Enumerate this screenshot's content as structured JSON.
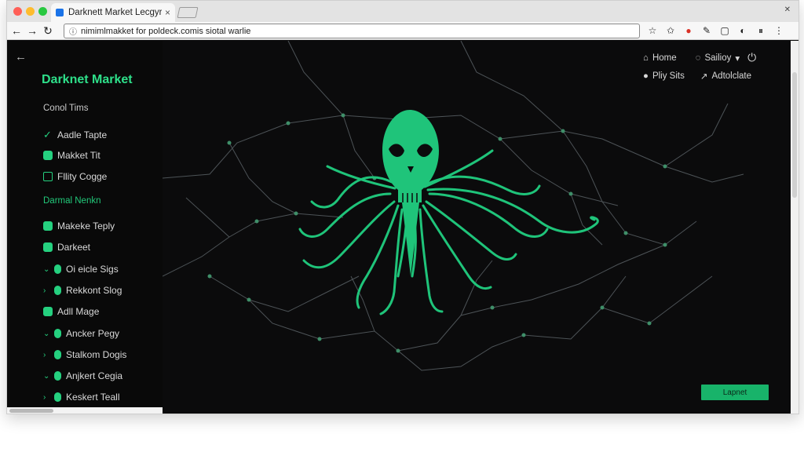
{
  "browser": {
    "tab_title": "Darknett Market Lecgyr",
    "url": "nimimlmakket for poldeck.comis siotal warlie",
    "traffic_lights": [
      "#ff5f57",
      "#febc2e",
      "#28c840"
    ]
  },
  "sidebar": {
    "brand": "Darknet Market",
    "section1_title": "Conol Tims",
    "section2_title": "Darmal Nenkn",
    "items": [
      {
        "label": "Aadle Tapte",
        "icon": "check-icon",
        "chev": ""
      },
      {
        "label": "Makket Tit",
        "icon": "square-filled-icon",
        "chev": ""
      },
      {
        "label": "Fllity Cogge",
        "icon": "square-outline-icon",
        "chev": ""
      },
      {
        "label": "Makeke Teply",
        "icon": "square-filled-icon",
        "chev": ""
      },
      {
        "label": "Darkeet",
        "icon": "square-filled-icon",
        "chev": ""
      },
      {
        "label": "Oi eicle Sigs",
        "icon": "pill-icon",
        "chev": "⌄"
      },
      {
        "label": "Rekkont Slog",
        "icon": "pill-icon",
        "chev": "›"
      },
      {
        "label": "Adll Mage",
        "icon": "grid-icon",
        "chev": ""
      },
      {
        "label": "Ancker Pegy",
        "icon": "pill-icon",
        "chev": "⌄"
      },
      {
        "label": "Stalkom Dogis",
        "icon": "pill-icon",
        "chev": "›"
      },
      {
        "label": "Anjkert Cegia",
        "icon": "pill-icon",
        "chev": "⌄"
      },
      {
        "label": "Keskert Teall",
        "icon": "pill-icon",
        "chev": "›"
      }
    ]
  },
  "topnav": {
    "home": "Home",
    "settings": "Sailioy",
    "play_sites": "Pliy Sits",
    "autoloate": "Adtolclate"
  },
  "cta_label": "Lapnet",
  "colors": {
    "accent": "#25d07f",
    "background": "#0b0b0c",
    "network_line": "#5a5f63"
  }
}
